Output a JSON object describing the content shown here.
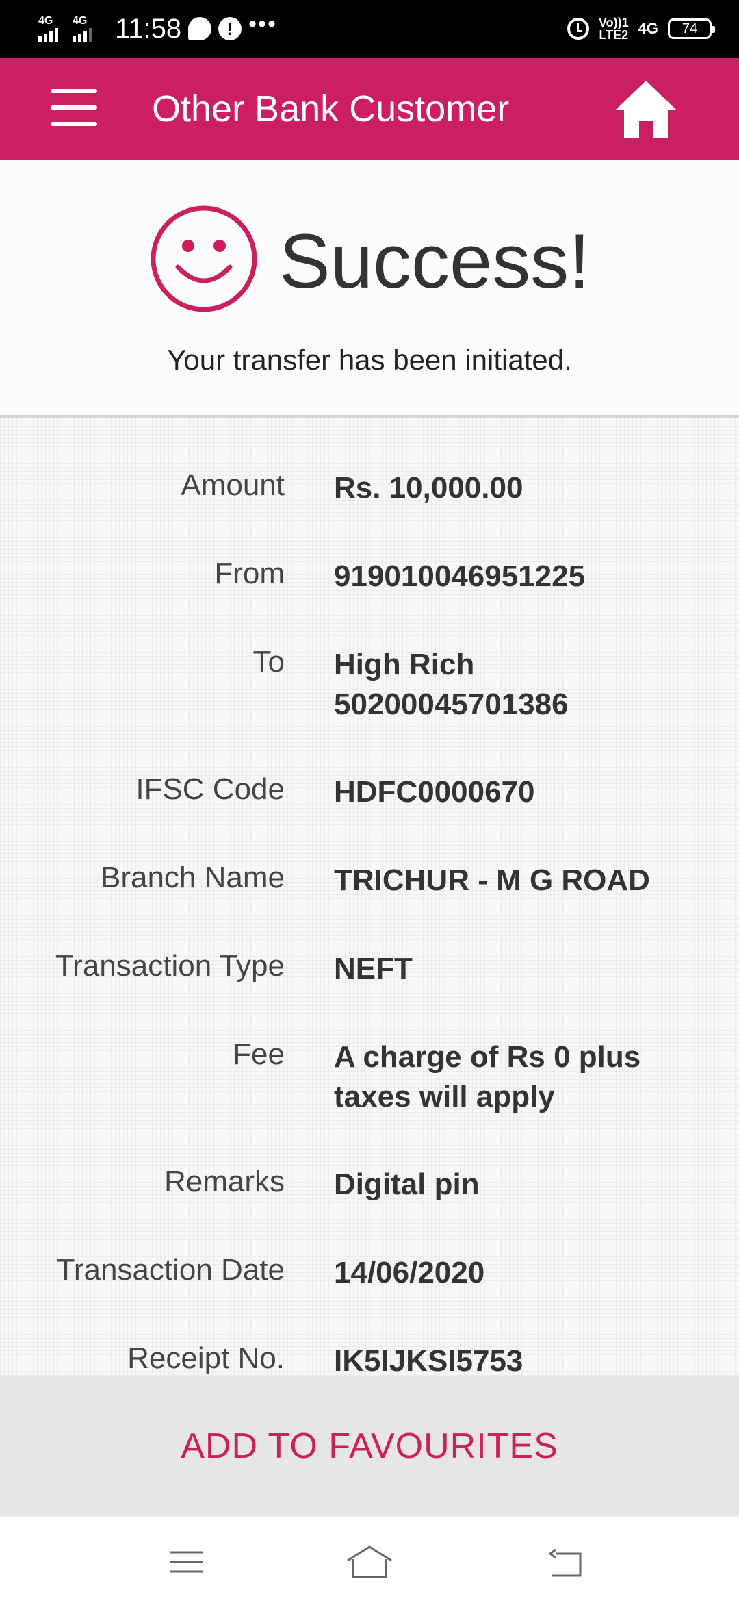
{
  "status_bar": {
    "sim1_network": "4G",
    "sim2_network": "4G",
    "time": "11:58",
    "volte_line1": "Vo))1",
    "volte_line2": "LTE2",
    "network_right": "4G",
    "battery": "74"
  },
  "app_bar": {
    "title": "Other Bank Customer"
  },
  "success": {
    "title": "Success!",
    "message": "Your transfer has been initiated."
  },
  "details": [
    {
      "label": "Amount",
      "value": "Rs. 10,000.00"
    },
    {
      "label": "From",
      "value": "919010046951225"
    },
    {
      "label": "To",
      "value_line1": "High Rich",
      "value_line2": "50200045701386"
    },
    {
      "label": "IFSC Code",
      "value": "HDFC0000670"
    },
    {
      "label": "Branch Name",
      "value": "TRICHUR - M G ROAD"
    },
    {
      "label": "Transaction Type",
      "value": "NEFT"
    },
    {
      "label": "Fee",
      "value_line1": "A charge of Rs 0 plus",
      "value_line2": "taxes will apply"
    },
    {
      "label": "Remarks",
      "value": "Digital pin"
    },
    {
      "label": "Transaction Date",
      "value": "14/06/2020"
    },
    {
      "label": "Receipt No.",
      "value": "IK5IJKSI5753"
    }
  ],
  "actions": {
    "add_favourites": "ADD TO FAVOURITES"
  },
  "colors": {
    "brand": "#cc1f5e",
    "text": "#333333"
  }
}
